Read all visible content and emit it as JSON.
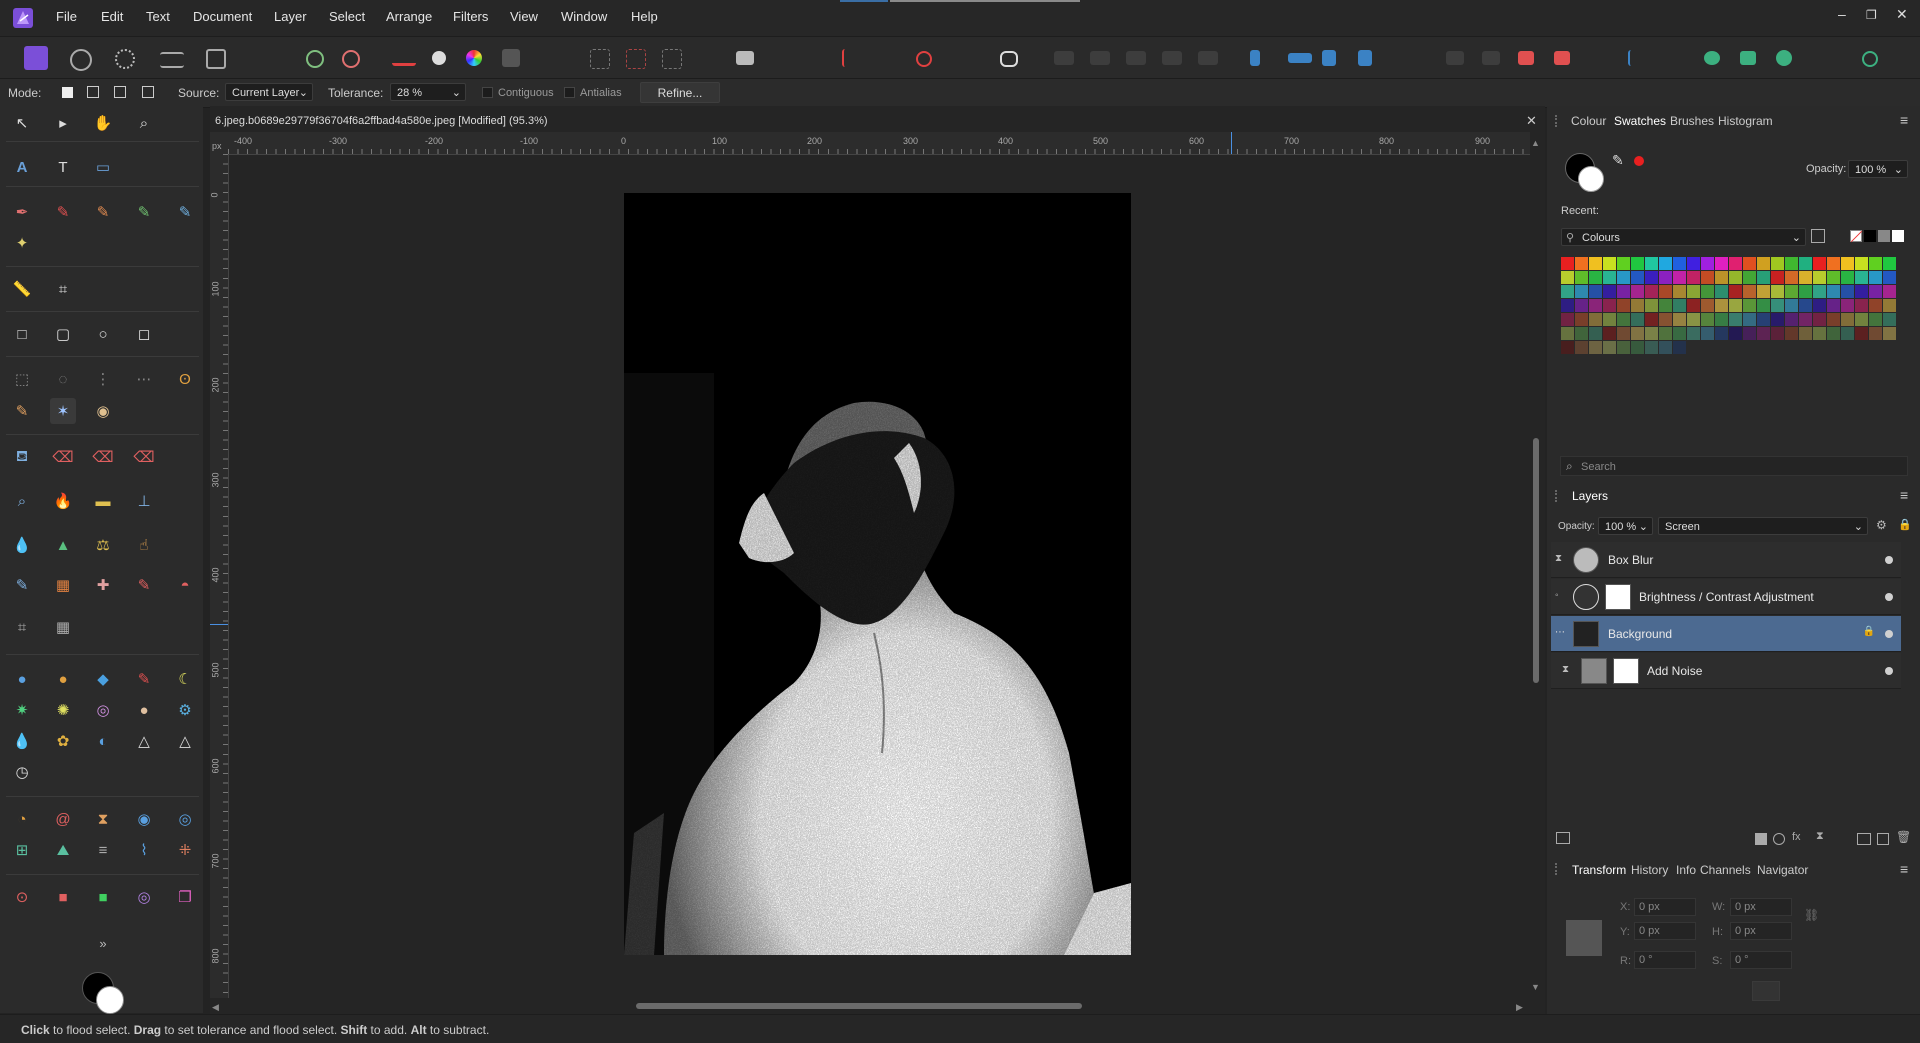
{
  "menu": [
    "File",
    "Edit",
    "Text",
    "Document",
    "Layer",
    "Select",
    "Arrange",
    "Filters",
    "View",
    "Window",
    "Help"
  ],
  "window_controls": {
    "minimize": "–",
    "restore": "❐",
    "close": "✕"
  },
  "context_bar": {
    "mode_label": "Mode:",
    "source_label": "Source:",
    "source_value": "Current Layer",
    "tolerance_label": "Tolerance:",
    "tolerance_value": "28 %",
    "contiguous_label": "Contiguous",
    "antialias_label": "Antialias",
    "refine_label": "Refine..."
  },
  "document": {
    "title": "6.jpeg.b0689e29779f36704f6a2ffbad4a580e.jpeg [Modified] (95.3%)",
    "close": "✕"
  },
  "ruler": {
    "unit": "px",
    "h_labels": [
      "-400",
      "-300",
      "-200",
      "-100",
      "0",
      "100",
      "200",
      "300",
      "400",
      "500",
      "600",
      "700",
      "800",
      "900"
    ],
    "v_labels": [
      "0",
      "100",
      "200",
      "300",
      "400",
      "500",
      "600",
      "700",
      "800"
    ]
  },
  "top_panel": {
    "tabs": [
      "Colour",
      "Swatches",
      "Brushes",
      "Histogram"
    ],
    "active_tab": "Swatches",
    "opacity_label": "Opacity:",
    "opacity_value": "100 %",
    "recent_label": "Recent:",
    "palette_name": "Colours",
    "search_placeholder": "Search"
  },
  "layers_panel": {
    "title": "Layers",
    "opacity_label": "Opacity:",
    "opacity_value": "100 %",
    "blend_mode": "Screen",
    "layers": [
      {
        "name": "Box Blur",
        "selected": false
      },
      {
        "name": "Brightness / Contrast Adjustment",
        "selected": false
      },
      {
        "name": "Background",
        "selected": true
      },
      {
        "name": "Add Noise",
        "selected": false
      }
    ]
  },
  "bottom_panel": {
    "tabs": [
      "Transform",
      "History",
      "Info",
      "Channels",
      "Navigator"
    ],
    "active_tab": "Transform",
    "x_label": "X:",
    "x_value": "0 px",
    "y_label": "Y:",
    "y_value": "0 px",
    "w_label": "W:",
    "w_value": "0 px",
    "h_label": "H:",
    "h_value": "0 px",
    "r_label": "R:",
    "r_value": "0 °",
    "s_label": "S:",
    "s_value": "0 °"
  },
  "status": {
    "b1": "Click",
    "t1": " to flood select. ",
    "b2": "Drag",
    "t2": " to set tolerance and flood select. ",
    "b3": "Shift",
    "t3": " to add. ",
    "b4": "Alt",
    "t4": " to subtract."
  },
  "colors": {
    "accent": "#4c6a91",
    "brand": "#7b4fd8",
    "primary": "#000000",
    "secondary": "#ffffff"
  },
  "swatch_colors": [
    "#e82020",
    "#f07020",
    "#f0c020",
    "#c8e020",
    "#60d020",
    "#20c840",
    "#20c8a0",
    "#20a8e0",
    "#2060e0",
    "#4020e0",
    "#a020e0",
    "#e020c0",
    "#e02070",
    "#e05020",
    "#d0a020",
    "#a0c820",
    "#40b830",
    "#20b080"
  ]
}
